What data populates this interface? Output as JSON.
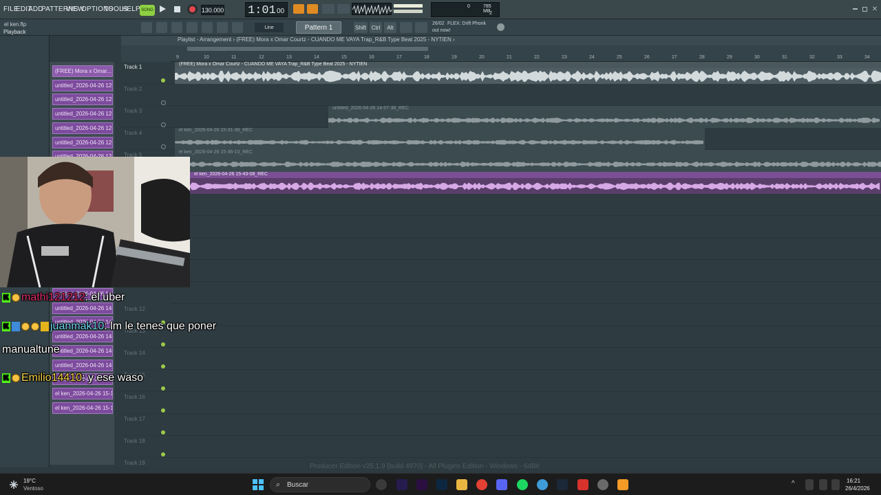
{
  "menu": [
    "FILE",
    "EDIT",
    "ADD",
    "PATTERNS",
    "VIEW",
    "OPTIONS",
    "TOOLS",
    "HELP"
  ],
  "transport": {
    "song_label": "SONG",
    "tempo": "130.000",
    "time": "1:01",
    "time_sub": "00",
    "pattern": "Pattern 1",
    "snap": "Line"
  },
  "project": {
    "file": "el ken.flp",
    "status": "Playback"
  },
  "cpu": {
    "value": "0",
    "ram": "785 MB",
    "poly": "2"
  },
  "modifiers": [
    "Shift",
    "Ctrl",
    "Alt"
  ],
  "news": {
    "date": "26/02",
    "line1": "FLEX: Drift Phonk",
    "line2": "out now!"
  },
  "playlist": {
    "breadcrumb": "Playlist - Arrangement › (FREE) Mora x Omar Courtz - CUANDO ME VAYA Trap_R&B Type Beat 2025 - NYTIEN ›"
  },
  "ruler": [
    "9",
    "10",
    "11",
    "12",
    "13",
    "14",
    "15",
    "16",
    "17",
    "18",
    "19",
    "20",
    "21",
    "22",
    "23",
    "24",
    "25",
    "26",
    "27",
    "28",
    "29",
    "30",
    "31",
    "32",
    "33",
    "34"
  ],
  "picker": [
    "(FREE) Mora x Omar...",
    "untitled_2026-04-26 12-...",
    "untitled_2026-04-26 12-...",
    "untitled_2026-04-26 12-...",
    "untitled_2026-04-26 12-...",
    "untitled_2026-04-26 12-...",
    "untitled_2026-04-26 12-...",
    "untitled_2026-04-26 14-...",
    "untitled_2026-04-26 14-...",
    "untitled_2026-04-26 14-...",
    "untitled_2026-04-26 14-...",
    "untitled_2026-04-26 14-...",
    "untitled_2026-04-26 14-...",
    "el ken_2026-04-26 15-1...",
    "el ken_2026-04-26 15-1...",
    "el ken_2026-04-26 15-1..."
  ],
  "tracks": [
    "Track 1",
    "Track 2",
    "Track 3",
    "Track 4",
    "Track 5",
    "Track 12",
    "Track 13",
    "Track 14",
    "Track 15",
    "Track 16",
    "Track 17",
    "Track 18",
    "Track 19"
  ],
  "clips": {
    "c1": "(FREE) Mora x Omar Courtz - CUANDO ME VAYA  Trap_R&B Type Beat 2025 - NYTIEN",
    "c2": "untitled_2026-04-26 14-07-38_REC",
    "c3": "el ken_2026-04-26 15-31-38_REC",
    "c4": "el ken_2026-04-26 15-36-10_REC",
    "c5": "el ken_2026-04-26 15-43-08_REC"
  },
  "chat": [
    {
      "user": "mathi121212",
      "msg": ": el uber",
      "color": "#e0306a"
    },
    {
      "user": "juanmak10",
      "msg": ": lm le tenes que poner",
      "msg2": "manualtune",
      "color": "#6fd7ef"
    },
    {
      "user": "Emilio14410",
      "msg": ": y ese waso",
      "color": "#f6d34a"
    }
  ],
  "footer": "Producer Edition v25.1.9 [build 4970] - All Plugins Edition - Windows - 64Bit",
  "taskbar": {
    "weather_temp": "19°C",
    "weather_desc": "Ventoso",
    "search": "Buscar",
    "time": "16:21",
    "date": "26/4/2026"
  }
}
